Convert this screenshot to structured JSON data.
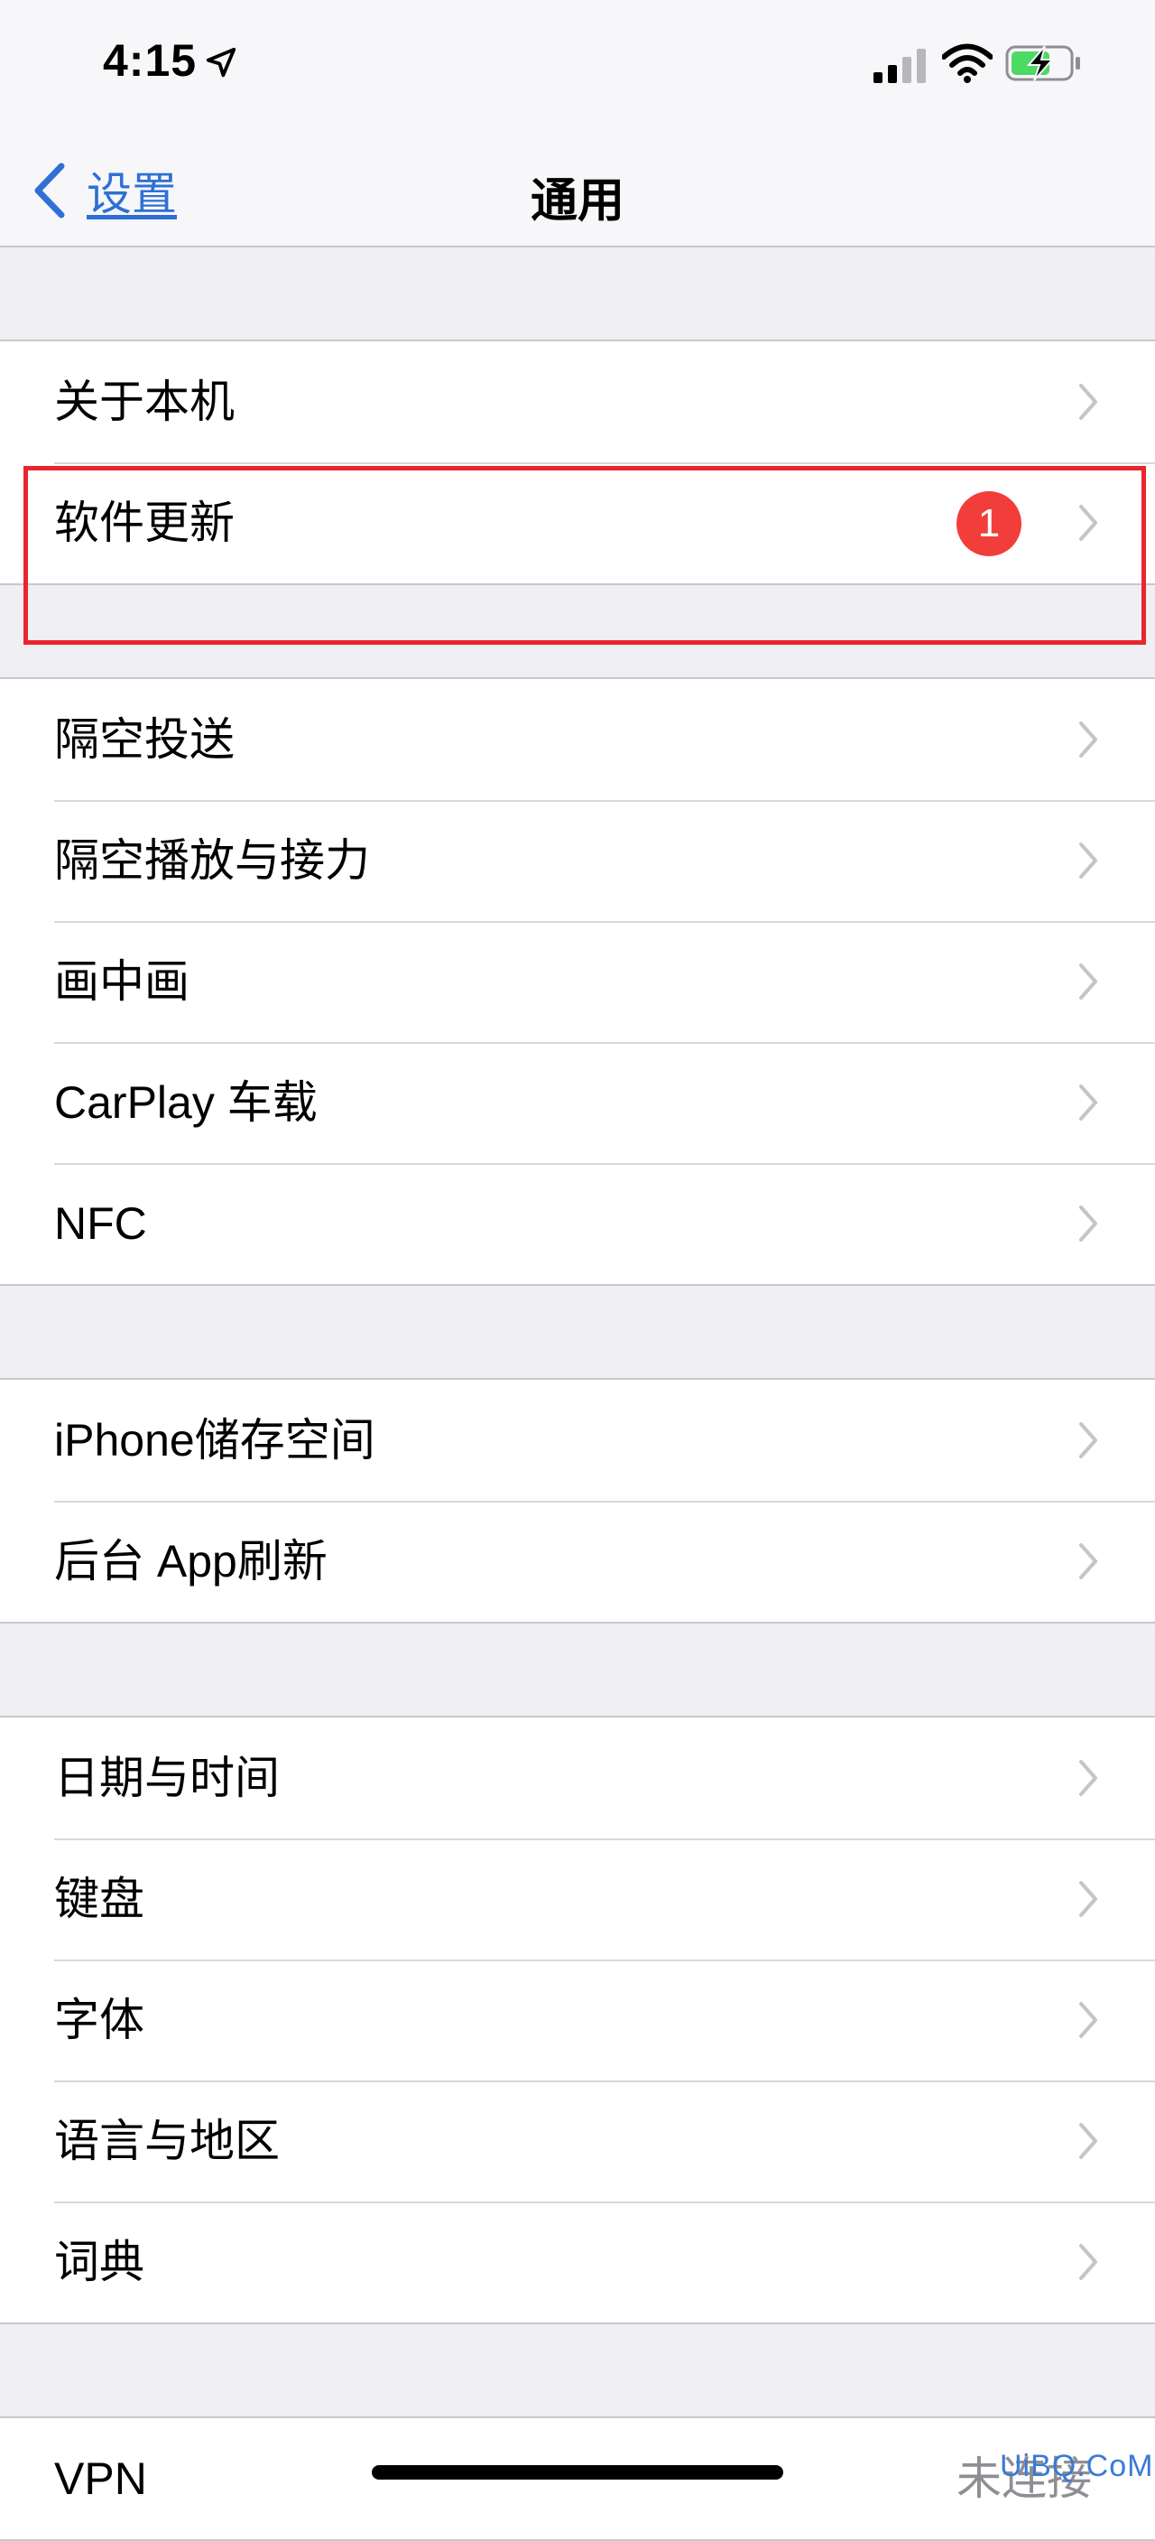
{
  "status_bar": {
    "time": "4:15",
    "icons": [
      "location-arrow-icon",
      "cellular-signal-icon",
      "wifi-icon",
      "battery-charging-icon"
    ],
    "battery_color": "#4cd964"
  },
  "nav": {
    "back_label": "设置",
    "title": "通用",
    "accent_color": "#2f6fd6"
  },
  "groups": [
    {
      "rows": [
        {
          "label": "关于本机"
        },
        {
          "label": "软件更新",
          "badge": "1"
        }
      ]
    },
    {
      "rows": [
        {
          "label": "隔空投送"
        },
        {
          "label": "隔空播放与接力"
        },
        {
          "label": "画中画"
        },
        {
          "label": "CarPlay 车载"
        },
        {
          "label": "NFC"
        }
      ]
    },
    {
      "rows": [
        {
          "label": "iPhone储存空间"
        },
        {
          "label": "后台 App刷新"
        }
      ]
    },
    {
      "rows": [
        {
          "label": "日期与时间"
        },
        {
          "label": "键盘"
        },
        {
          "label": "字体"
        },
        {
          "label": "语言与地区"
        },
        {
          "label": "词典"
        }
      ]
    },
    {
      "rows": [
        {
          "label": "VPN",
          "value": "未连接"
        }
      ]
    }
  ],
  "badge_color": "#f23e3a",
  "highlight_color": "#e8262d",
  "watermark": "UiBQ.CoM"
}
